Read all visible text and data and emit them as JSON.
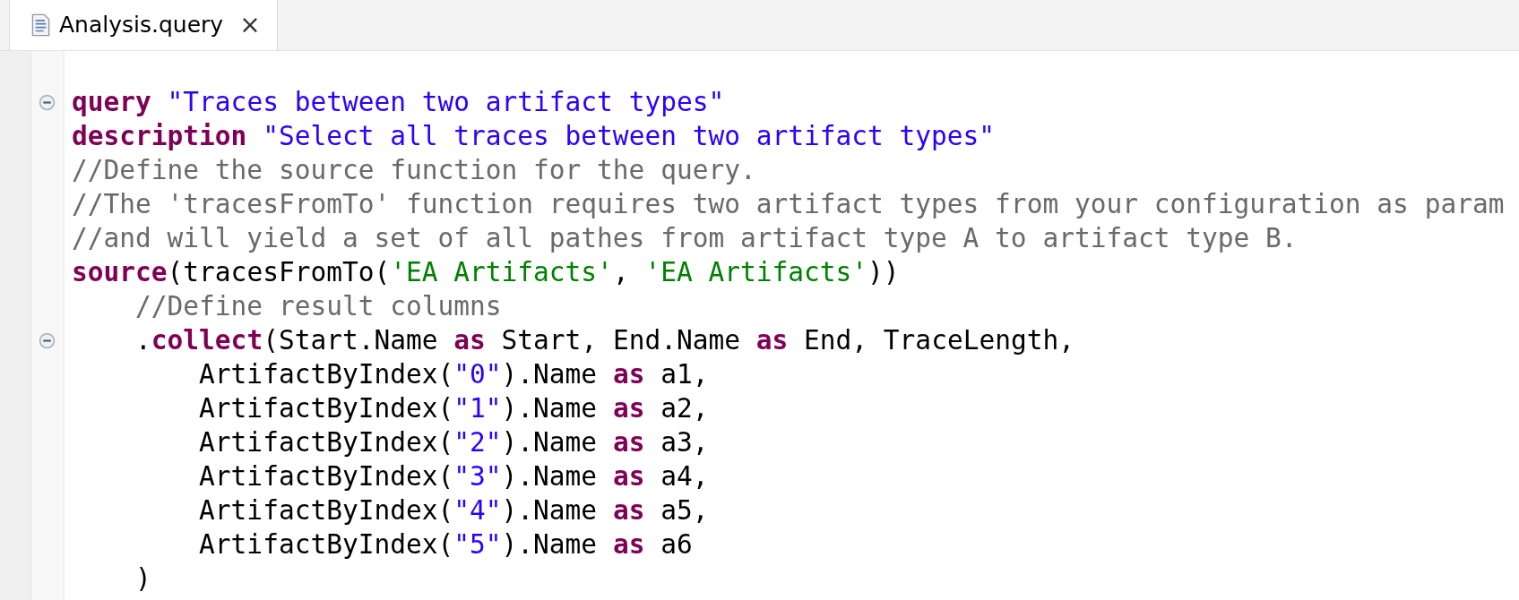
{
  "tabs": [
    {
      "label": "Analysis.query",
      "selected": true,
      "close": "×"
    }
  ],
  "editor": {
    "lines": [
      {
        "fold": {
          "expanded": true
        },
        "tokens": [
          {
            "kind": "keyword",
            "text": "query"
          },
          {
            "kind": "string",
            "text": " \"Traces between two artifact types\""
          }
        ]
      },
      {
        "tokens": [
          {
            "kind": "keyword",
            "text": "description"
          },
          {
            "kind": "string",
            "text": " \"Select all traces between two artifact types\""
          }
        ]
      },
      {
        "tokens": [
          {
            "kind": "comment",
            "text": "//Define the source function for the query."
          }
        ]
      },
      {
        "tokens": [
          {
            "kind": "comment",
            "text": "//The 'tracesFromTo' function requires two artifact types from your configuration as param"
          }
        ]
      },
      {
        "tokens": [
          {
            "kind": "comment",
            "text": "//and will yield a set of all pathes from artifact type A to artifact type B."
          }
        ]
      },
      {
        "tokens": [
          {
            "kind": "keyword",
            "text": "source"
          },
          {
            "kind": "plain",
            "text": "(tracesFromTo("
          },
          {
            "kind": "literal",
            "text": "'EA Artifacts'"
          },
          {
            "kind": "plain",
            "text": ", "
          },
          {
            "kind": "literal",
            "text": "'EA Artifacts'"
          },
          {
            "kind": "plain",
            "text": "))"
          }
        ]
      },
      {
        "tokens": [
          {
            "kind": "comment",
            "text": "    //Define result columns"
          }
        ]
      },
      {
        "fold": {
          "expanded": true
        },
        "tokens": [
          {
            "kind": "plain",
            "text": "    ."
          },
          {
            "kind": "keyword",
            "text": "collect"
          },
          {
            "kind": "plain",
            "text": "(Start.Name "
          },
          {
            "kind": "keyword",
            "text": "as"
          },
          {
            "kind": "plain",
            "text": " Start, End.Name "
          },
          {
            "kind": "keyword",
            "text": "as"
          },
          {
            "kind": "plain",
            "text": " End, TraceLength,"
          }
        ]
      },
      {
        "tokens": [
          {
            "kind": "plain",
            "text": "        ArtifactByIndex("
          },
          {
            "kind": "string",
            "text": "\"0\""
          },
          {
            "kind": "plain",
            "text": ").Name "
          },
          {
            "kind": "keyword",
            "text": "as"
          },
          {
            "kind": "plain",
            "text": " a1,"
          }
        ]
      },
      {
        "tokens": [
          {
            "kind": "plain",
            "text": "        ArtifactByIndex("
          },
          {
            "kind": "string",
            "text": "\"1\""
          },
          {
            "kind": "plain",
            "text": ").Name "
          },
          {
            "kind": "keyword",
            "text": "as"
          },
          {
            "kind": "plain",
            "text": " a2,"
          }
        ]
      },
      {
        "tokens": [
          {
            "kind": "plain",
            "text": "        ArtifactByIndex("
          },
          {
            "kind": "string",
            "text": "\"2\""
          },
          {
            "kind": "plain",
            "text": ").Name "
          },
          {
            "kind": "keyword",
            "text": "as"
          },
          {
            "kind": "plain",
            "text": " a3,"
          }
        ]
      },
      {
        "tokens": [
          {
            "kind": "plain",
            "text": "        ArtifactByIndex("
          },
          {
            "kind": "string",
            "text": "\"3\""
          },
          {
            "kind": "plain",
            "text": ").Name "
          },
          {
            "kind": "keyword",
            "text": "as"
          },
          {
            "kind": "plain",
            "text": " a4,"
          }
        ]
      },
      {
        "tokens": [
          {
            "kind": "plain",
            "text": "        ArtifactByIndex("
          },
          {
            "kind": "string",
            "text": "\"4\""
          },
          {
            "kind": "plain",
            "text": ").Name "
          },
          {
            "kind": "keyword",
            "text": "as"
          },
          {
            "kind": "plain",
            "text": " a5,"
          }
        ]
      },
      {
        "tokens": [
          {
            "kind": "plain",
            "text": "        ArtifactByIndex("
          },
          {
            "kind": "string",
            "text": "\"5\""
          },
          {
            "kind": "plain",
            "text": ").Name "
          },
          {
            "kind": "keyword",
            "text": "as"
          },
          {
            "kind": "plain",
            "text": " a6"
          }
        ]
      },
      {
        "tokens": [
          {
            "kind": "plain",
            "text": "    )"
          }
        ]
      }
    ]
  }
}
